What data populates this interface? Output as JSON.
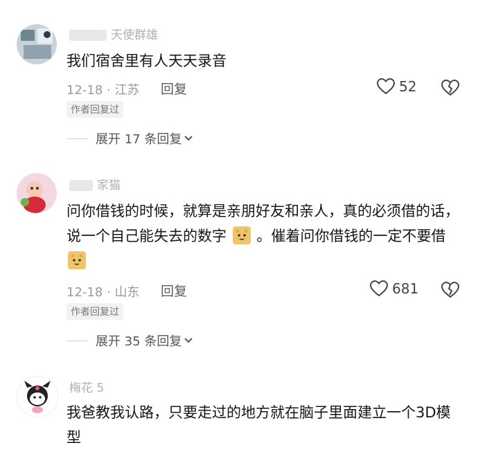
{
  "comments": [
    {
      "username": "天使群雄",
      "text": "我们宿舍里有人天天录音",
      "date_location": "12-18 · 江苏",
      "reply_label": "回复",
      "likes": "52",
      "author_badge": "作者回复过",
      "expand_label": "展开 17 条回复"
    },
    {
      "username": "家猫",
      "text_part1": "问你借钱的时候，就算是亲朋好友和亲人，真的必须借的话，说一个自己能失去的数字",
      "text_part2": "。催着问你借钱的一定不要借",
      "date_location": "12-18 · 山东",
      "reply_label": "回复",
      "likes": "681",
      "author_badge": "作者回复过",
      "expand_label": "展开 35 条回复"
    },
    {
      "username": "梅花 5",
      "text": "我爸教我认路，只要走过的地方就在脑子里面建立一个3D模型"
    }
  ],
  "icons": {
    "like": "heart-outline-icon",
    "dislike": "broken-heart-icon",
    "expand": "chevron-down-icon",
    "emoji": "cat-emoji-icon"
  },
  "colors": {
    "text": "#161616",
    "meta": "#9a9a9a",
    "badge_bg": "#f2f2f2"
  }
}
